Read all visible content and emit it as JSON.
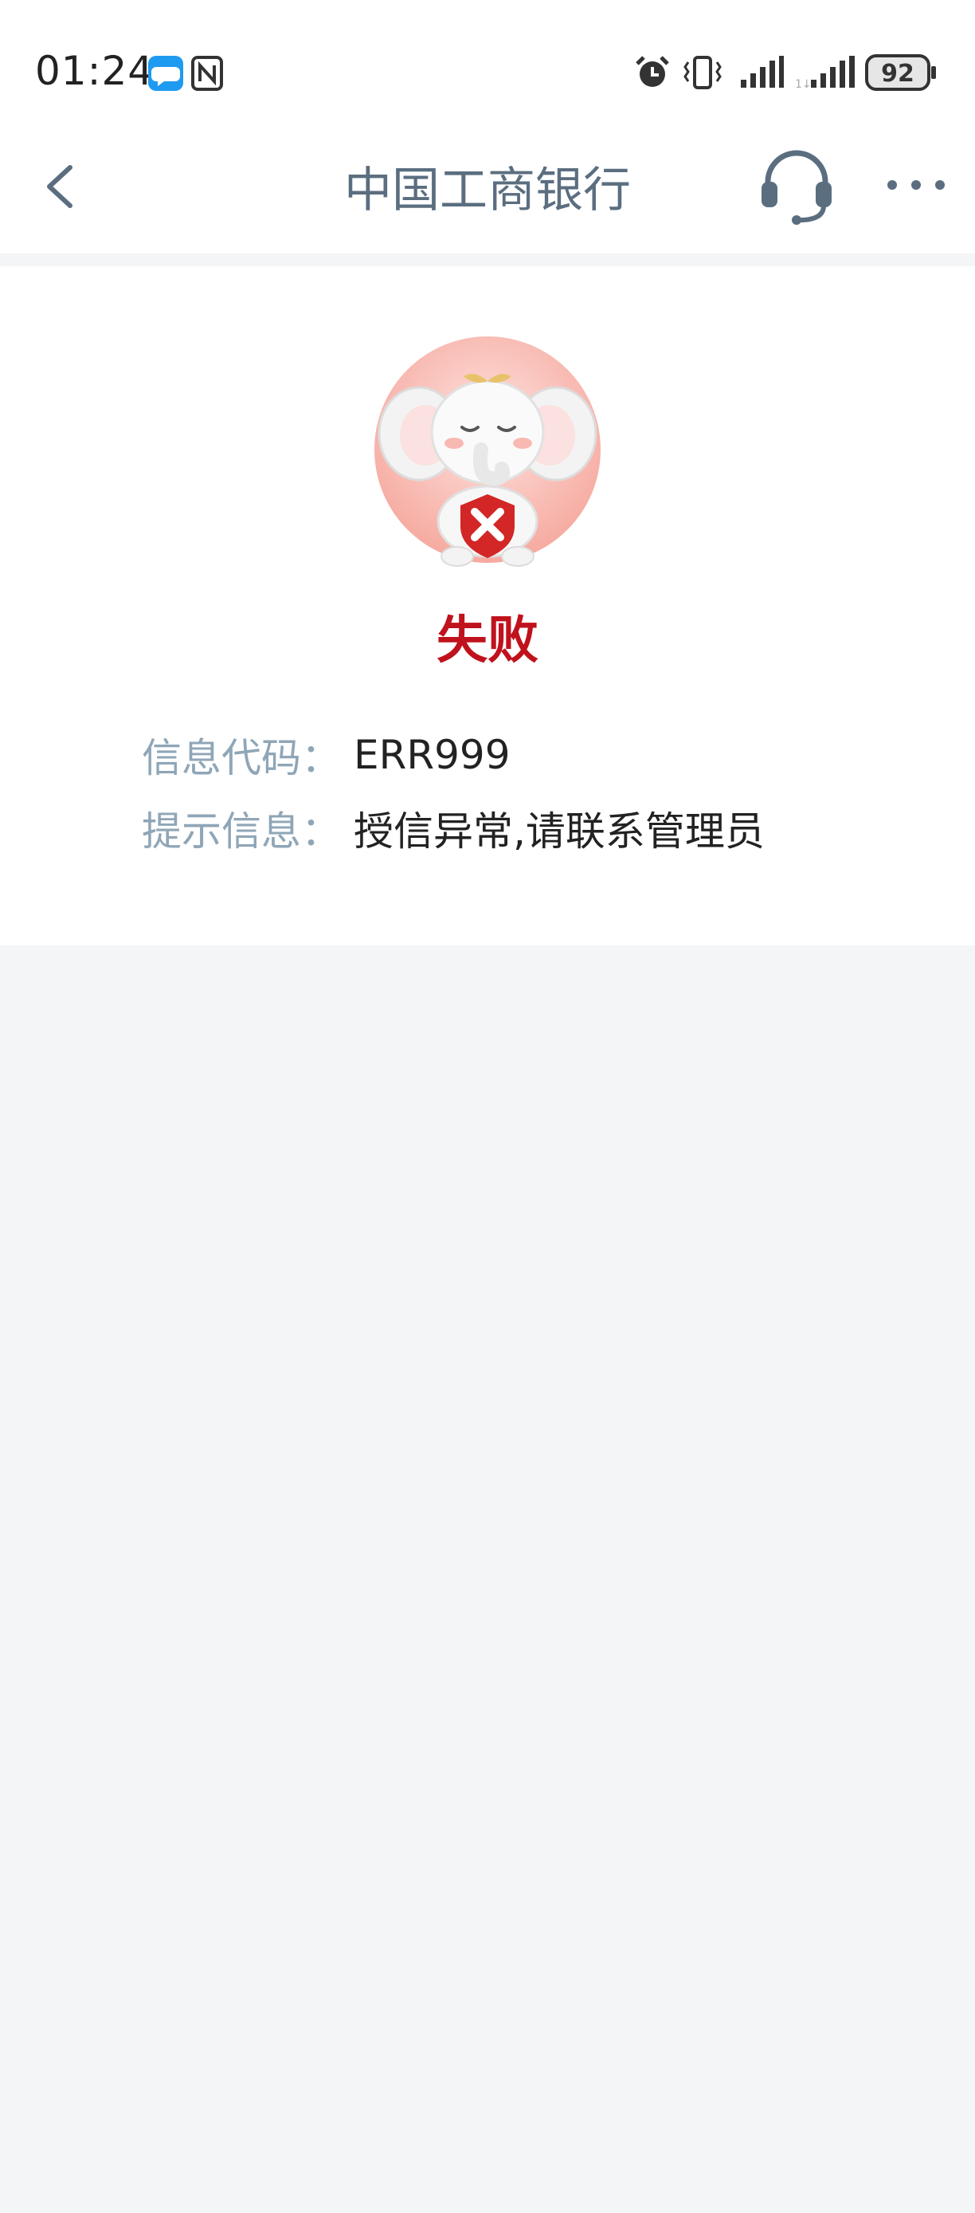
{
  "status_bar": {
    "time": "01:24",
    "battery": "92",
    "icons": [
      "message-app-icon",
      "nfc-icon",
      "alarm-icon",
      "vibrate-icon",
      "signal-icon",
      "signal-icon-2",
      "battery-icon"
    ]
  },
  "header": {
    "title": "中国工商银行",
    "back_icon": "chevron-left-icon",
    "support_icon": "headset-icon",
    "more_icon": "more-icon"
  },
  "result": {
    "status_title": "失败",
    "mascot": "elephant-failure-illustration",
    "rows": [
      {
        "label": "信息代码：",
        "value": "ERR999"
      },
      {
        "label": "提示信息：",
        "value": "授信异常,请联系管理员"
      }
    ]
  },
  "colors": {
    "error_red": "#c0121d",
    "nav_text": "#5b6e80",
    "label_gray": "#8fa6b7",
    "page_bg": "#f4f5f7"
  }
}
